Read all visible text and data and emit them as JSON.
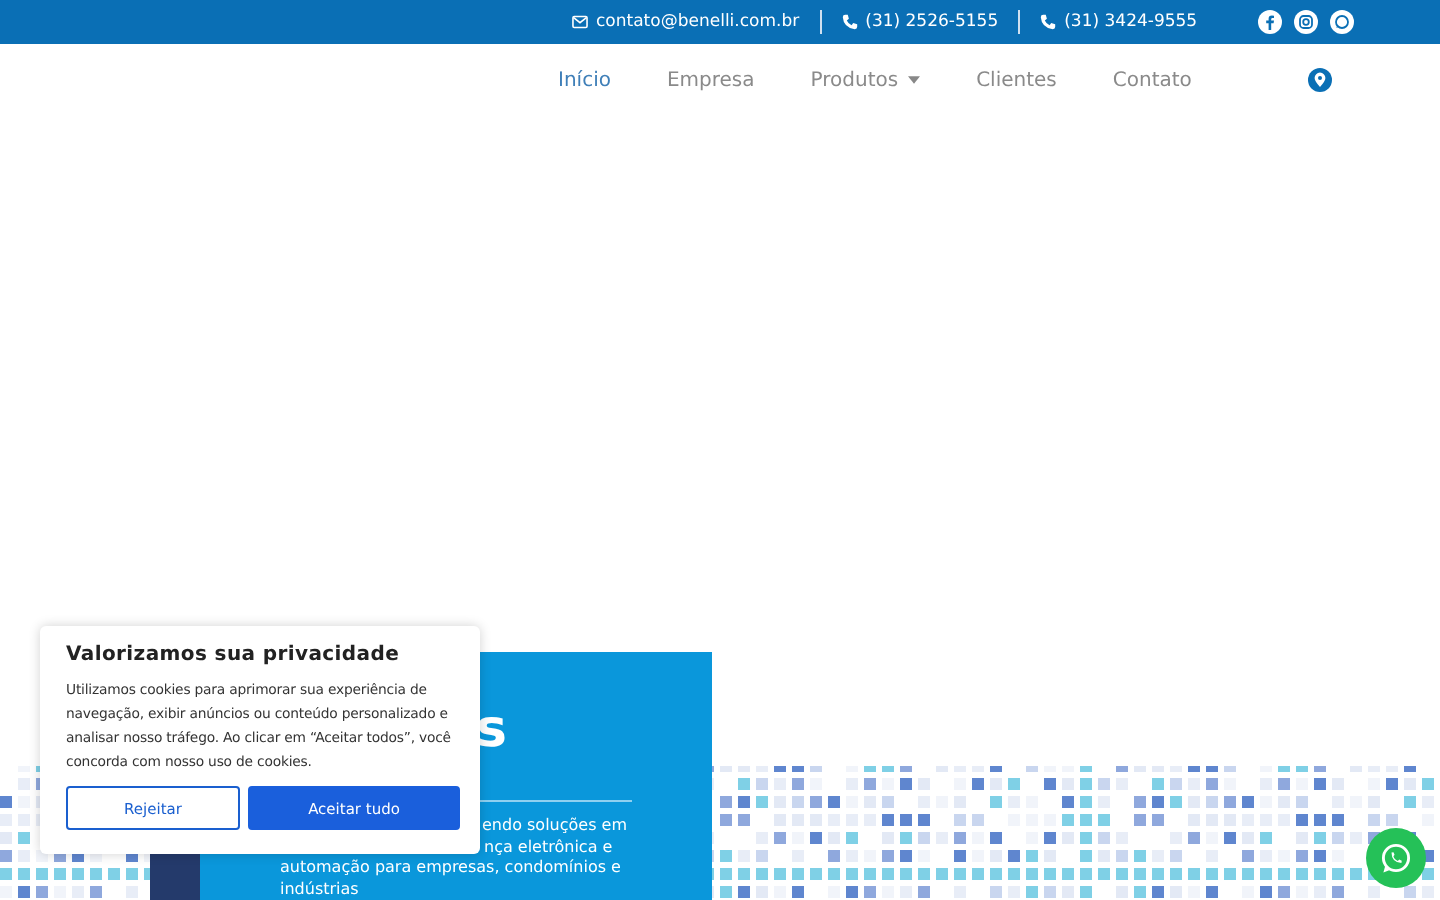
{
  "top_bar": {
    "email": "contato@benelli.com.br",
    "phones": [
      "(31) 2526-5155",
      "(31) 3424-9555"
    ]
  },
  "nav": {
    "items": [
      {
        "label": "Início",
        "selected": true,
        "dropdown": false
      },
      {
        "label": "Empresa",
        "selected": false,
        "dropdown": false
      },
      {
        "label": "Produtos",
        "selected": false,
        "dropdown": true
      },
      {
        "label": "Clientes",
        "selected": false,
        "dropdown": false
      },
      {
        "label": "Contato",
        "selected": false,
        "dropdown": false
      }
    ]
  },
  "hero": {
    "heading": "s",
    "lines": [
      "endo soluções em",
      "nça eletrônica e",
      "automação para empresas, condomínios e",
      "indústrias"
    ]
  },
  "cookie": {
    "title": "Valorizamos sua privacidade",
    "text": "Utilizamos cookies para aprimorar sua experiência de navegação, exibir anúncios ou conteúdo personalizado e analisar nosso tráfego. Ao clicar em “Aceitar todos”, você concorda com nosso uso de cookies.",
    "buttons": [
      {
        "label": "Rejeitar",
        "kind": "outline"
      },
      {
        "label": "Aceitar tudo",
        "kind": "primary"
      }
    ]
  }
}
